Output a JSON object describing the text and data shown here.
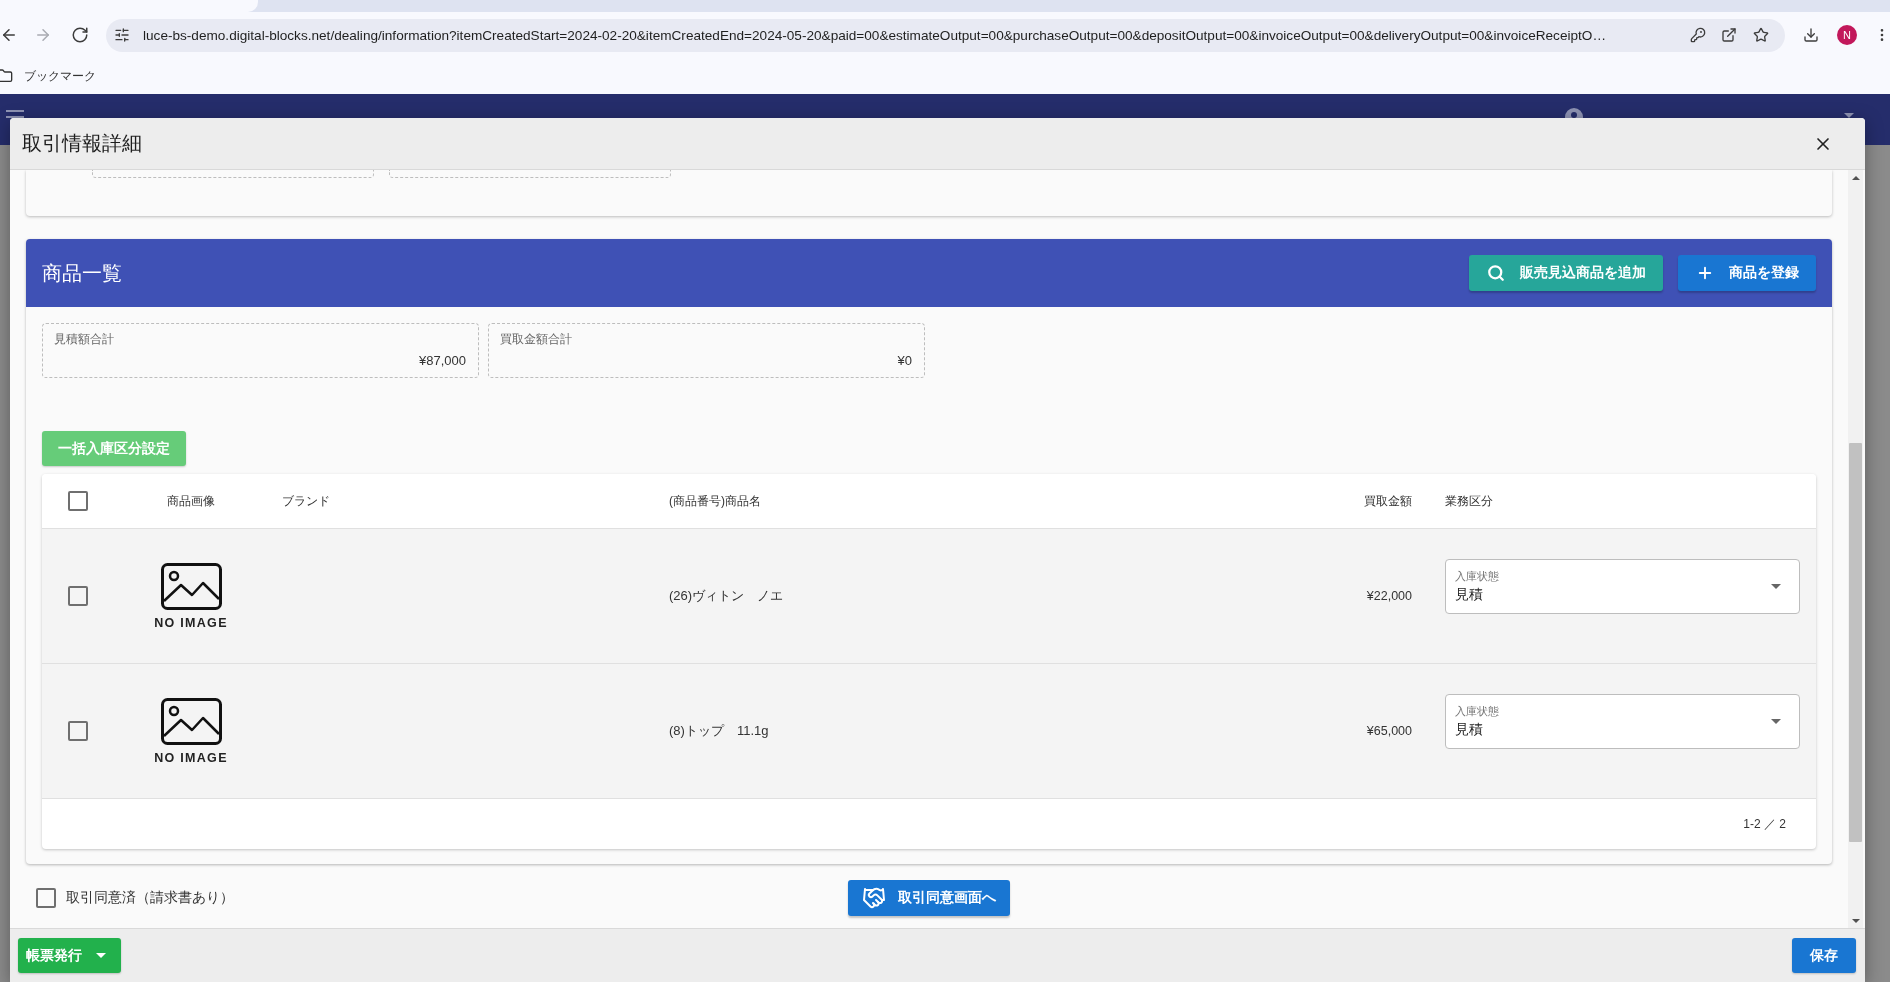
{
  "browser": {
    "url": "luce-bs-demo.digital-blocks.net/dealing/information?itemCreatedStart=2024-02-20&itemCreatedEnd=2024-05-20&paid=00&estimateOutput=00&purchaseOutput=00&depositOutput=00&invoiceOutput=00&deliveryOutput=00&invoiceReceiptO…",
    "back_enabled": true,
    "forward_enabled": false,
    "profile_initial": "N",
    "bookmarks_label": "ブックマーク"
  },
  "dialog": {
    "title": "取引情報詳細",
    "products": {
      "title": "商品一覧",
      "actions": [
        {
          "kind": "search",
          "label": "販売見込商品を追加"
        },
        {
          "kind": "add",
          "label": "商品を登録"
        }
      ],
      "totals": [
        {
          "label": "見積額合計",
          "value": "¥87,000"
        },
        {
          "label": "買取金額合計",
          "value": "¥0"
        }
      ],
      "bulk_button": {
        "label": "一括入庫区分設定",
        "disabled": true
      },
      "table": {
        "select_all": false,
        "columns": [
          "商品画像",
          "ブランド",
          "(商品番号)商品名",
          "買取金額",
          "業務区分"
        ],
        "rows": [
          {
            "checked": false,
            "image_label": "NO IMAGE",
            "name": "(26)ヴィトン　ノエ",
            "price": "¥22,000",
            "status": {
              "label": "入庫状態",
              "value": "見積"
            }
          },
          {
            "checked": false,
            "image_label": "NO IMAGE",
            "name": "(8)トップ　11.1g",
            "price": "¥65,000",
            "status": {
              "label": "入庫状態",
              "value": "見積"
            }
          }
        ],
        "pagination": "1-2 ／ 2"
      }
    },
    "agreement": {
      "label": "取引同意済（請求書あり）",
      "checked": false
    },
    "agree_button": "取引同意画面へ",
    "footer": {
      "report_button": "帳票発行",
      "save_button": "保存"
    }
  }
}
